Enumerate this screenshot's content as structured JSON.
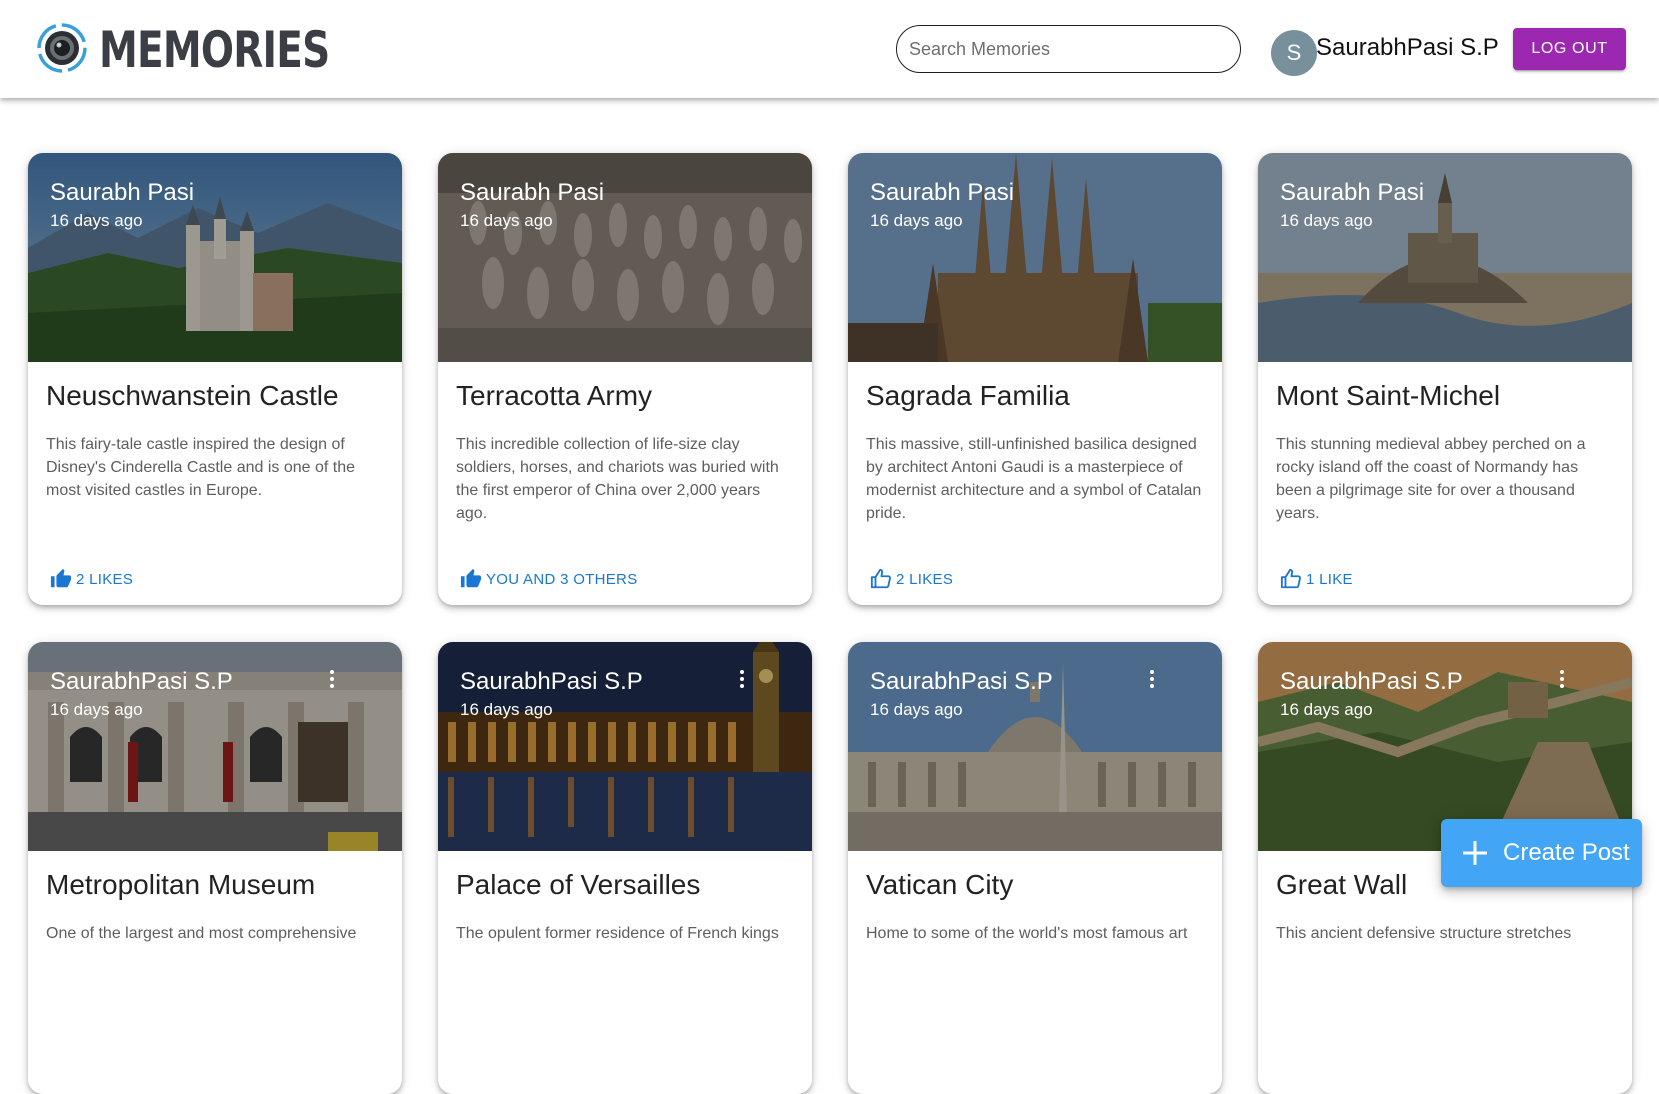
{
  "app": {
    "brand": "MEMORIES",
    "logo_icon": "camera-lens-icon"
  },
  "search": {
    "placeholder": "Search Memories",
    "value": ""
  },
  "user": {
    "avatar_initial": "S",
    "avatar_color": "#78909c",
    "name": "SaurabhPasi S.P",
    "logout_label": "LOG OUT",
    "logout_color": "#9c27b0"
  },
  "posts": [
    {
      "author": "Saurabh Pasi",
      "time": "16 days ago",
      "title": "Neuschwanstein Castle",
      "description": "This fairy-tale castle inspired the design of Disney's Cinderella Castle and is one of the most visited castles in Europe.",
      "likes": "2 LIKES",
      "liked": true,
      "has_menu": false
    },
    {
      "author": "Saurabh Pasi",
      "time": "16 days ago",
      "title": "Terracotta Army",
      "description": "This incredible collection of life-size clay soldiers, horses, and chariots was buried with the first emperor of China over 2,000 years ago.",
      "likes": "YOU AND 3 OTHERS",
      "liked": true,
      "has_menu": false
    },
    {
      "author": "Saurabh Pasi",
      "time": "16 days ago",
      "title": "Sagrada Familia",
      "description": "This massive, still-unfinished basilica designed by architect Antoni Gaudi is a masterpiece of modernist architecture and a symbol of Catalan pride.",
      "likes": "2 LIKES",
      "liked": false,
      "has_menu": false
    },
    {
      "author": "Saurabh Pasi",
      "time": "16 days ago",
      "title": "Mont Saint-Michel",
      "description": "This stunning medieval abbey perched on a rocky island off the coast of Normandy has been a pilgrimage site for over a thousand years.",
      "likes": "1 LIKE",
      "liked": false,
      "has_menu": false
    },
    {
      "author": "SaurabhPasi S.P",
      "time": "16 days ago",
      "title": "Metropolitan Museum",
      "description": "One of the largest and most comprehensive",
      "has_menu": true
    },
    {
      "author": "SaurabhPasi S.P",
      "time": "16 days ago",
      "title": "Palace of Versailles",
      "description": "The opulent former residence of French kings",
      "has_menu": true
    },
    {
      "author": "SaurabhPasi S.P",
      "time": "16 days ago",
      "title": "Vatican City",
      "description": "Home to some of the world's most famous art",
      "has_menu": true
    },
    {
      "author": "SaurabhPasi S.P",
      "time": "16 days ago",
      "title": "Great Wall",
      "description": "This ancient defensive structure stretches",
      "has_menu": true
    }
  ],
  "fab": {
    "label": "Create Post",
    "icon": "plus-icon",
    "color": "#42a5f5"
  },
  "colors": {
    "like_blue": "#1976d2"
  }
}
